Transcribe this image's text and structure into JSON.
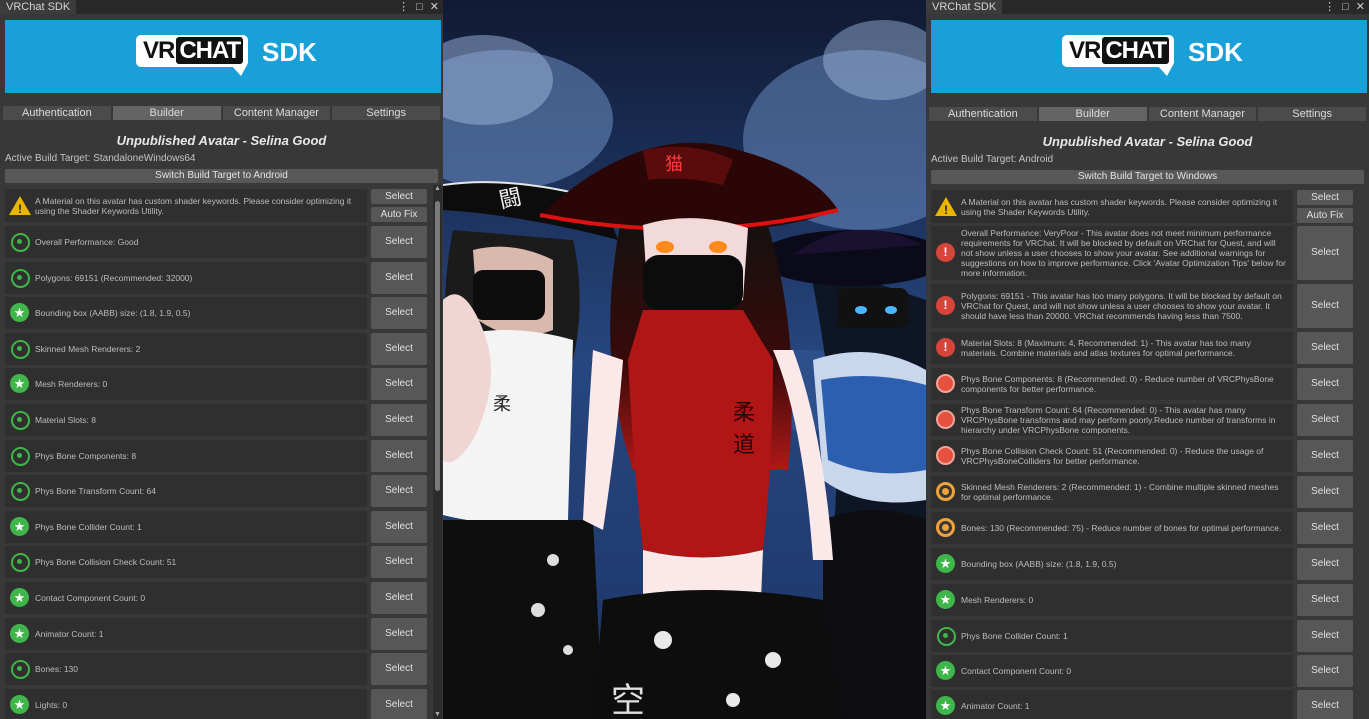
{
  "window_tab": "VRChat SDK",
  "logo": {
    "vr": "VR",
    "chat": "CHAT",
    "sdk": "SDK"
  },
  "nav_tabs": [
    "Authentication",
    "Builder",
    "Content Manager",
    "Settings"
  ],
  "colors": {
    "banner": "#1aa0d8",
    "good": "#3fb64a",
    "warning": "#e8b500",
    "bad": "#d9443a",
    "medium": "#f0a33a"
  },
  "left": {
    "title": "Unpublished Avatar - Selina Good",
    "build_target": "Active Build Target: StandaloneWindows64",
    "switch_label": "Switch Build Target to Android",
    "warning": {
      "icon": "warning-icon",
      "text": "A Material on this avatar has custom shader keywords. Please consider optimizing it using the Shader Keywords Utility.",
      "select": "Select",
      "autofix": "Auto Fix"
    },
    "rows": [
      {
        "icon": "good",
        "text": "Overall Performance: Good",
        "select": "Select"
      },
      {
        "icon": "good",
        "text": "Polygons: 69151 (Recommended: 32000)",
        "select": "Select"
      },
      {
        "icon": "excellent",
        "text": "Bounding box (AABB) size: (1.8, 1.9, 0.5)",
        "select": "Select"
      },
      {
        "icon": "good",
        "text": "Skinned Mesh Renderers: 2",
        "select": "Select"
      },
      {
        "icon": "excellent",
        "text": "Mesh Renderers: 0",
        "select": "Select"
      },
      {
        "icon": "good",
        "text": "Material Slots: 8",
        "select": "Select"
      },
      {
        "icon": "good",
        "text": "Phys Bone Components: 8",
        "select": "Select"
      },
      {
        "icon": "good",
        "text": "Phys Bone Transform Count: 64",
        "select": "Select"
      },
      {
        "icon": "excellent",
        "text": "Phys Bone Collider Count: 1",
        "select": "Select"
      },
      {
        "icon": "good",
        "text": "Phys Bone Collision Check Count: 51",
        "select": "Select"
      },
      {
        "icon": "excellent",
        "text": "Contact Component Count: 0",
        "select": "Select"
      },
      {
        "icon": "excellent",
        "text": "Animator Count: 1",
        "select": "Select"
      },
      {
        "icon": "good",
        "text": "Bones: 130",
        "select": "Select"
      },
      {
        "icon": "excellent",
        "text": "Lights: 0",
        "select": "Select"
      }
    ]
  },
  "right": {
    "title": "Unpublished Avatar - Selina Good",
    "build_target": "Active Build Target: Android",
    "switch_label": "Switch Build Target to Windows",
    "warning": {
      "icon": "warning-icon",
      "text": "A Material on this avatar has custom shader keywords. Please consider optimizing it using the Shader Keywords Utility.",
      "select": "Select",
      "autofix": "Auto Fix"
    },
    "rows": [
      {
        "icon": "bad",
        "text": "Overall Performance: VeryPoor - This avatar does not meet minimum performance requirements for VRChat. It will be blocked by default on VRChat for Quest, and will not show unless a user chooses to show your avatar. See additional warnings for suggestions on how to improve performance. Click 'Avatar Optimization Tips' below for more information.",
        "select": "Select"
      },
      {
        "icon": "bad",
        "text": "Polygons: 69151 - This avatar has too many polygons. It will be blocked by default on VRChat for Quest, and will not show unless a user chooses to show your avatar. It should have less than 20000. VRChat recommends having less than 7500.",
        "select": "Select"
      },
      {
        "icon": "bad",
        "text": "Material Slots: 8 (Maximum: 4, Recommended: 1) - This avatar has too many materials. Combine materials and atlas textures for optimal performance.",
        "select": "Select"
      },
      {
        "icon": "poor",
        "text": "Phys Bone Components: 8 (Recommended: 0) - Reduce number of VRCPhysBone components for better performance.",
        "select": "Select"
      },
      {
        "icon": "poor",
        "text": "Phys Bone Transform Count: 64 (Recommended: 0) - This avatar has many VRCPhysBone transforms and may perform poorly.Reduce number of transforms in hierarchy under VRCPhysBone components.",
        "select": "Select"
      },
      {
        "icon": "poor",
        "text": "Phys Bone Collision Check Count: 51 (Recommended: 0) - Reduce the usage of VRCPhysBoneColliders for better performance.",
        "select": "Select"
      },
      {
        "icon": "medium",
        "text": "Skinned Mesh Renderers: 2 (Recommended: 1) - Combine multiple skinned meshes for optimal performance.",
        "select": "Select"
      },
      {
        "icon": "medium",
        "text": "Bones: 130 (Recommended: 75) - Reduce number of bones for optimal performance.",
        "select": "Select"
      },
      {
        "icon": "excellent",
        "text": "Bounding box (AABB) size: (1.8, 1.9, 0.5)",
        "select": "Select"
      },
      {
        "icon": "excellent",
        "text": "Mesh Renderers: 0",
        "select": "Select"
      },
      {
        "icon": "good",
        "text": "Phys Bone Collider Count: 1",
        "select": "Select"
      },
      {
        "icon": "excellent",
        "text": "Contact Component Count: 0",
        "select": "Select"
      },
      {
        "icon": "excellent",
        "text": "Animator Count: 1",
        "select": "Select"
      }
    ]
  },
  "scene": {
    "left_shirt_glyph": "柔",
    "center_shirt_glyph_1": "柔",
    "center_shirt_glyph_2": "道",
    "center_hat_glyph": "猫",
    "left_hat_glyph": "闘",
    "skirt_glyph": "空"
  }
}
